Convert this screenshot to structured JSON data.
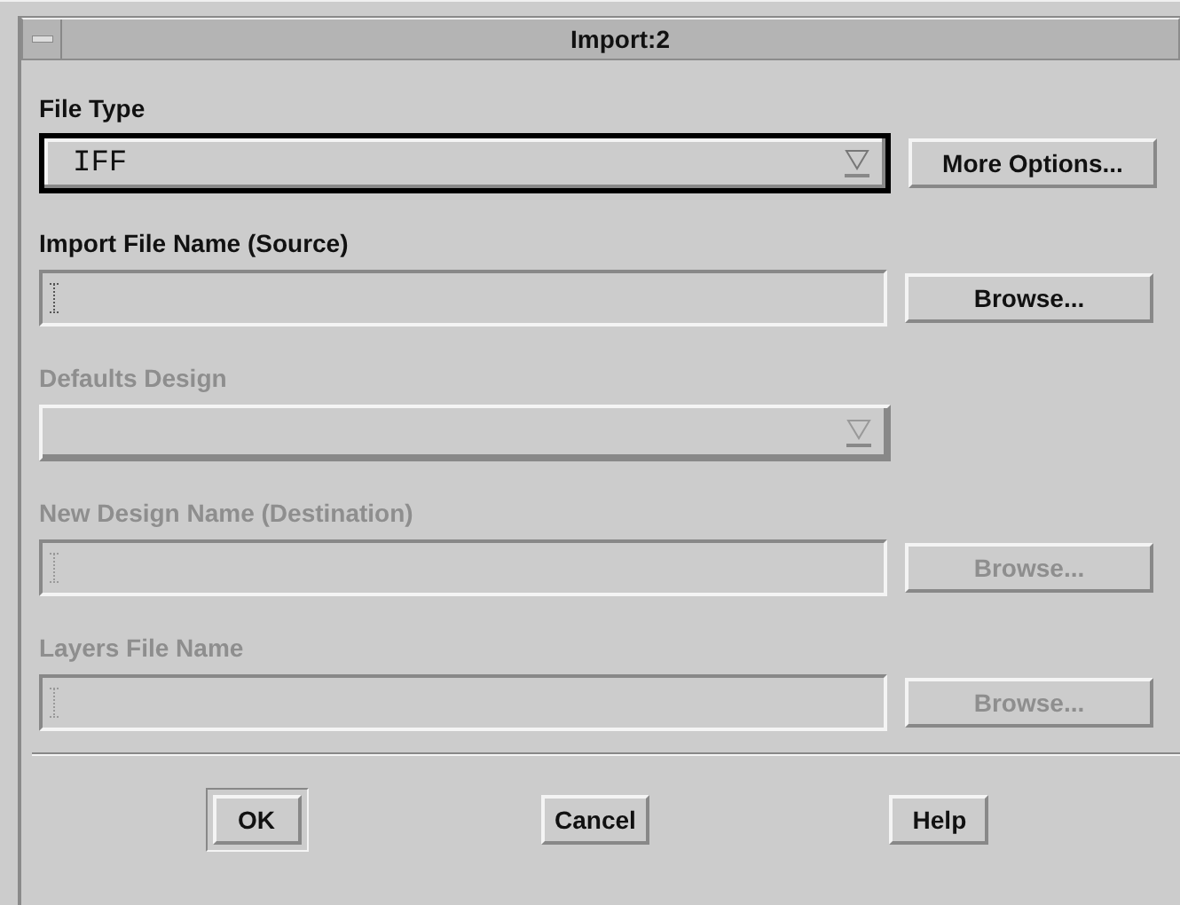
{
  "window": {
    "title": "Import:2"
  },
  "sections": [
    {
      "label": "File Type",
      "kind": "dropdown",
      "value": "IFF",
      "disabled": false,
      "focused": true,
      "button": {
        "label": "More Options...",
        "disabled": false
      }
    },
    {
      "label": "Import File Name (Source)",
      "kind": "text",
      "disabled": false,
      "focused": false,
      "button": {
        "label": "Browse...",
        "disabled": false
      }
    },
    {
      "label": "Defaults Design",
      "kind": "dropdown",
      "disabled": true,
      "focused": false
    },
    {
      "label": "New Design Name (Destination)",
      "kind": "text",
      "disabled": true,
      "focused": false,
      "button": {
        "label": "Browse...",
        "disabled": true
      }
    },
    {
      "label": "Layers File Name",
      "kind": "text",
      "disabled": true,
      "focused": false,
      "button": {
        "label": "Browse...",
        "disabled": true
      }
    }
  ],
  "buttons": [
    {
      "label": "OK",
      "default": true
    },
    {
      "label": "Cancel",
      "default": false
    },
    {
      "label": "Help",
      "default": false
    }
  ]
}
